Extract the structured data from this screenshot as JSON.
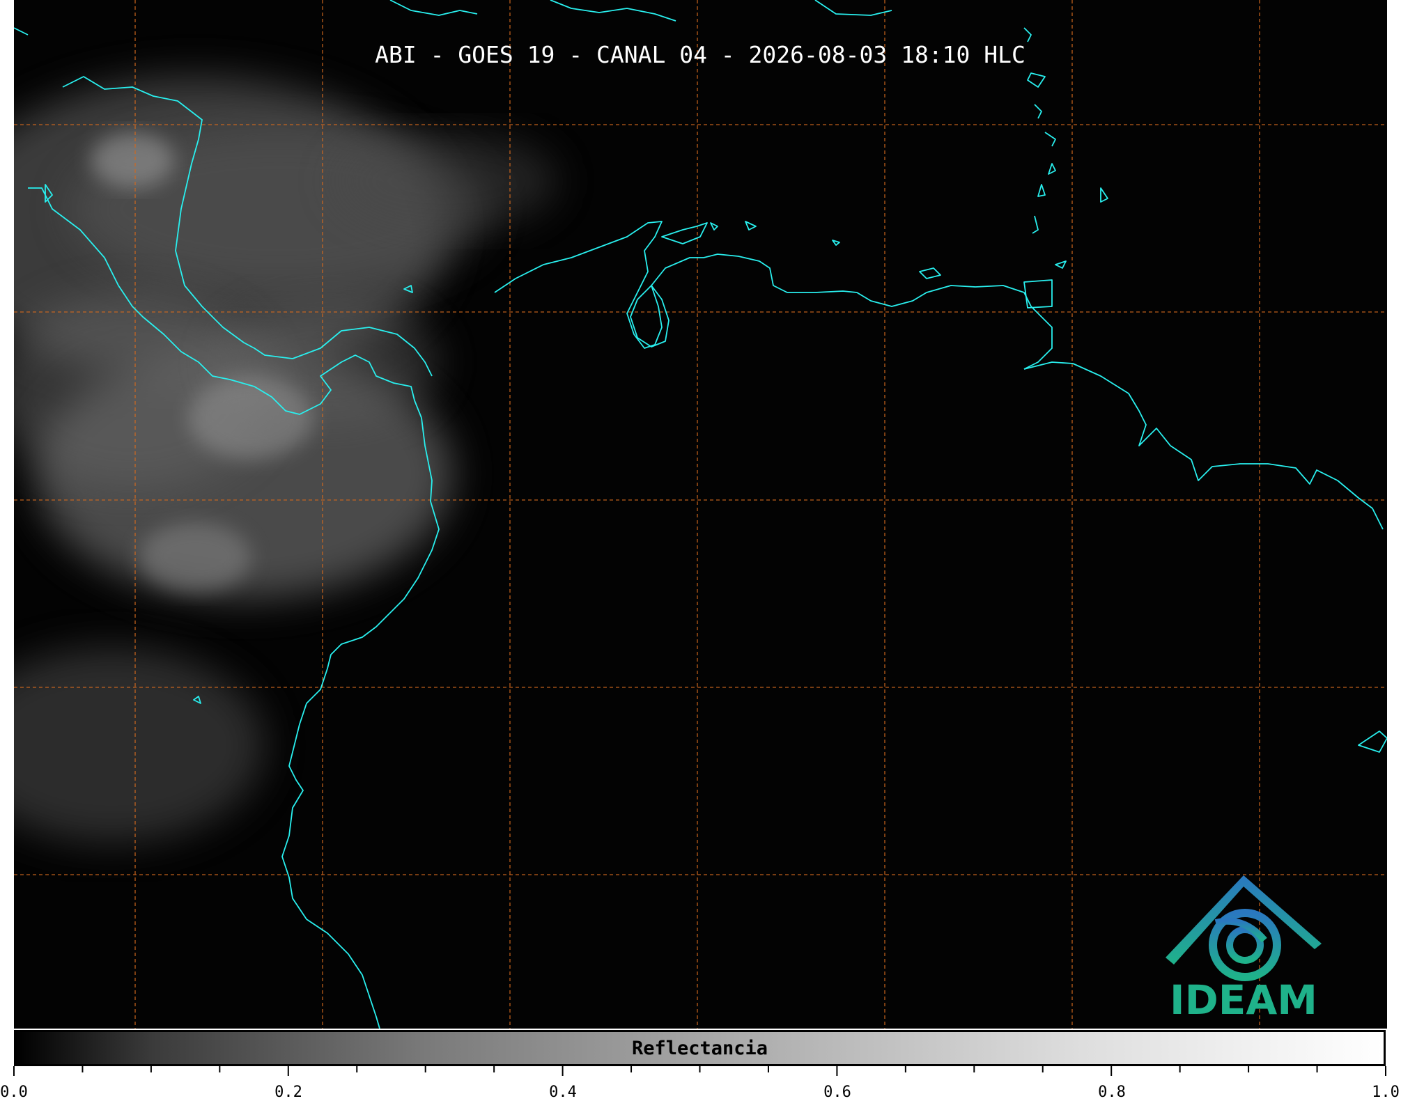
{
  "title": "ABI - GOES 19 - CANAL 04 - 2026-08-03 18:10 HLC",
  "colorbar": {
    "label": "Reflectancia",
    "ticks": [
      "0.0",
      "0.2",
      "0.4",
      "0.6",
      "0.8",
      "1.0"
    ],
    "range": [
      0.0,
      1.0
    ],
    "minor_step": 0.05
  },
  "logo": {
    "text": "IDEAM"
  },
  "colors": {
    "coastline": "#29f0ef",
    "grid": "#d2691e",
    "background": "#030303",
    "logo_blue": "#2a78c0",
    "logo_green": "#1fb28a"
  }
}
